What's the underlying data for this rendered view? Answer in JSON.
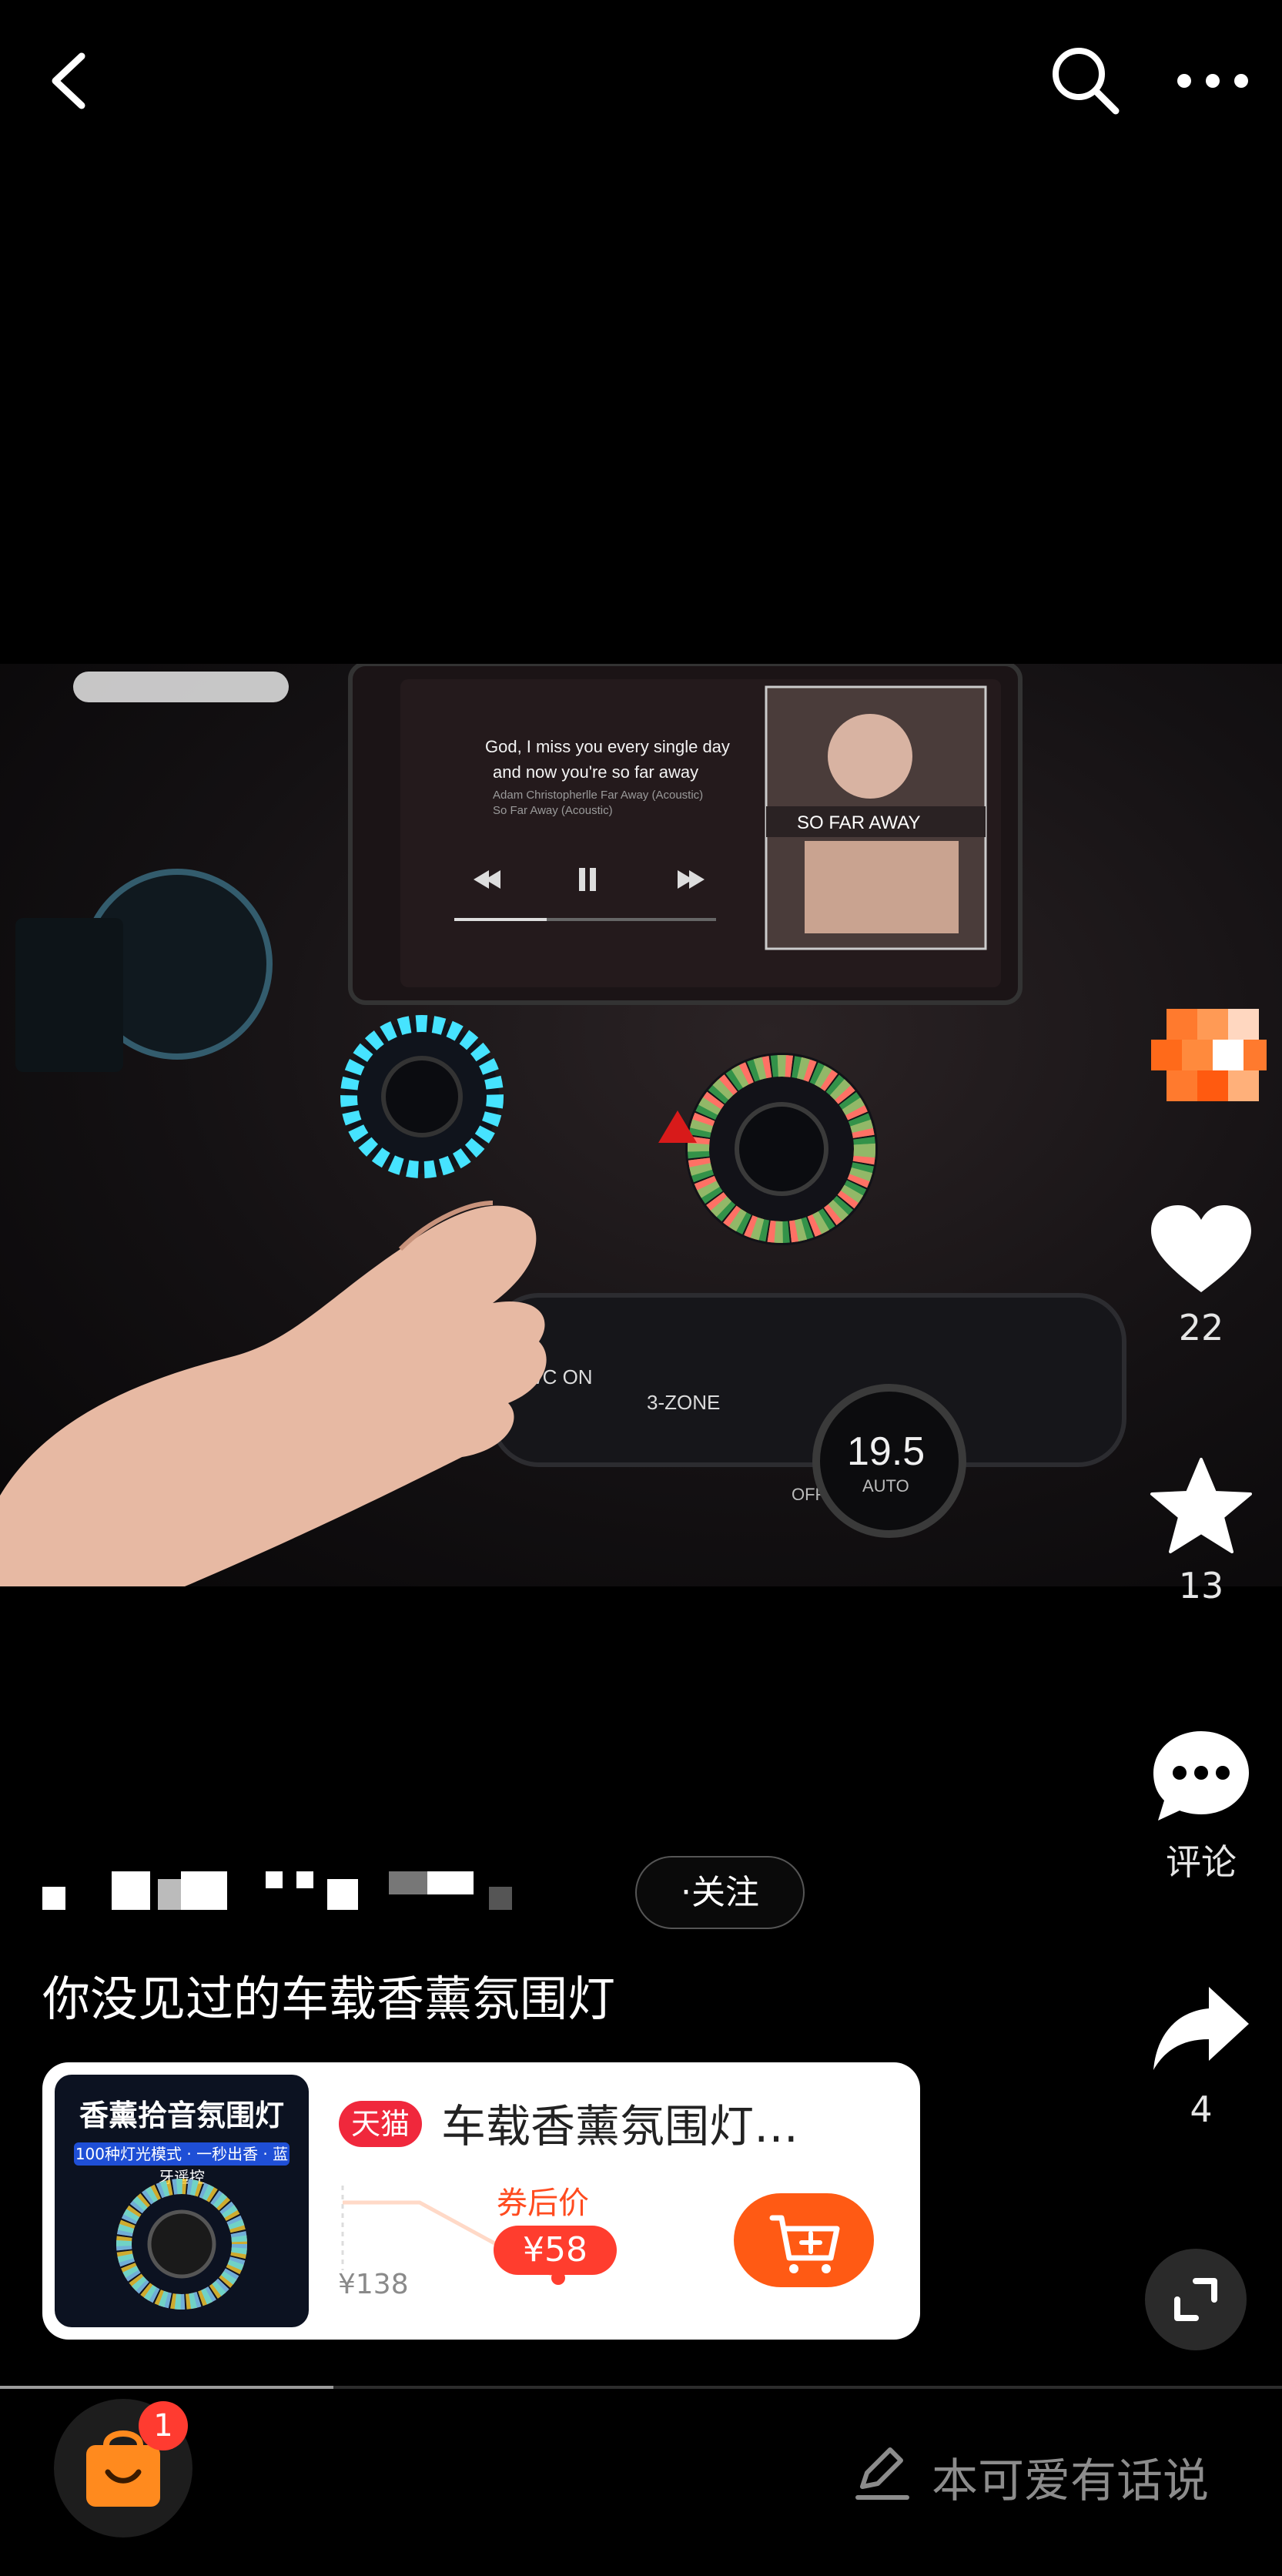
{
  "header": {
    "back_icon": "chevron-left-icon",
    "search_icon": "search-icon",
    "more_icon": "more-horizontal-icon"
  },
  "video": {
    "screen_lyrics_line1": "God, I miss you every single day",
    "screen_lyrics_line2": "and now you're so far away",
    "screen_song": "Adam Christopherlle Far Away (Acoustic)",
    "screen_album": "So Far Away (Acoustic)",
    "album_art_text": "SO FAR AWAY",
    "climate_temp": "19.5",
    "climate_mode": "AUTO",
    "ac_label": "A/C ON",
    "zone_label": "3-ZONE",
    "off_label": "OFF",
    "progress": 0.26
  },
  "actions": {
    "like_count": "22",
    "favorite_count": "13",
    "comment_label": "评论",
    "share_count": "4"
  },
  "author": {
    "follow_label": "·关注"
  },
  "caption": "你没见过的车载香薰氛围灯",
  "product": {
    "thumb_title": "香薰拾音氛围灯",
    "thumb_subtitle": "100种灯光模式 · 一秒出香 · 蓝牙遥控",
    "store_badge": "天猫",
    "title": "车载香薰氛围灯…",
    "coupon_label": "券后价",
    "coupon_price": "¥58",
    "original_price": "¥138",
    "cart_icon": "add-to-cart-icon"
  },
  "bottom_bar": {
    "bag_icon": "shopping-bag-icon",
    "bag_badge_count": "1",
    "comment_placeholder": "本可爱有话说",
    "pen_icon": "pen-icon"
  },
  "colors": {
    "background": "#000000",
    "accent_orange": "#ff5a14",
    "price_red": "#ff3d2e",
    "tmall_red": "#f0283c",
    "badge_red": "#ff3b30"
  }
}
